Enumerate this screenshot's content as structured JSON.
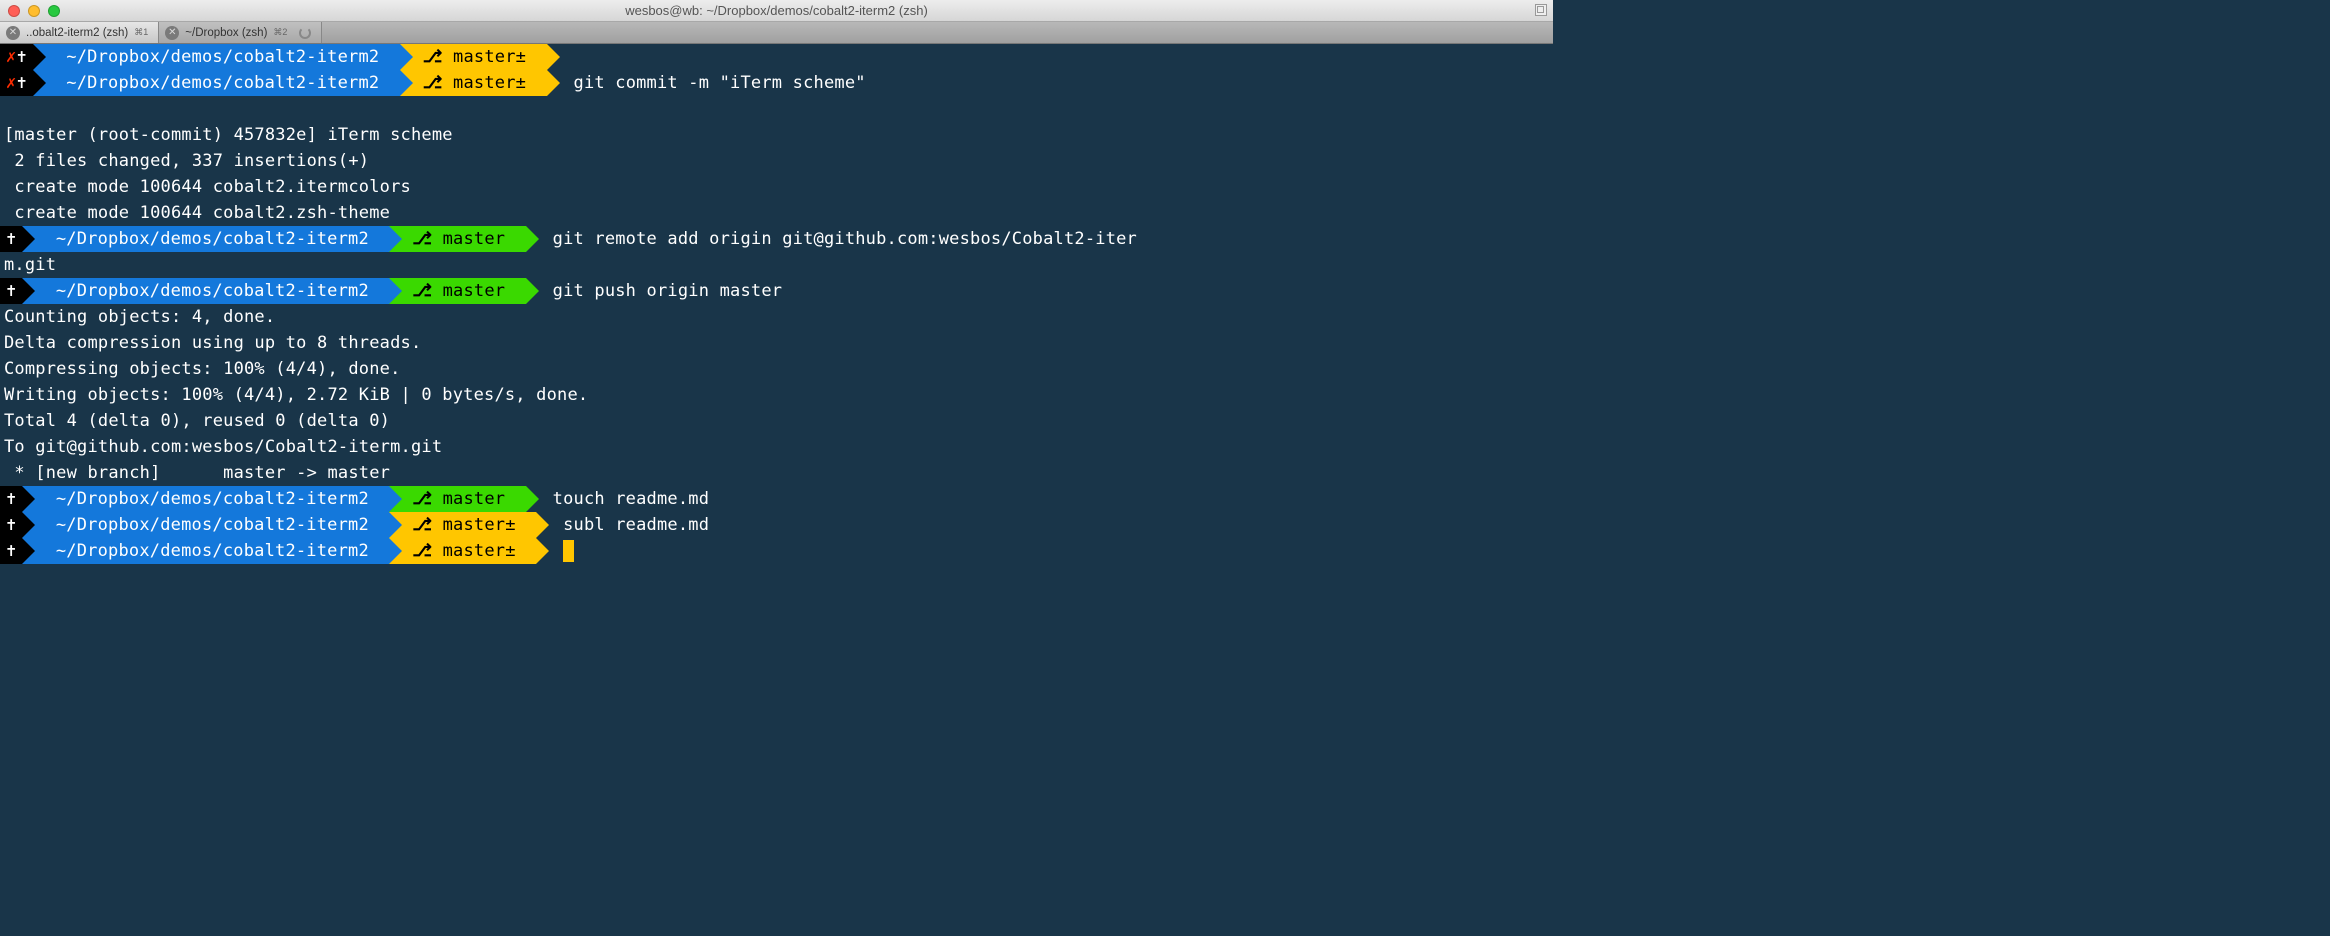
{
  "window": {
    "title": "wesbos@wb: ~/Dropbox/demos/cobalt2-iterm2 (zsh)"
  },
  "tabs": [
    {
      "label": "..obalt2-iterm2 (zsh)",
      "shortcut": "⌘1",
      "active": true
    },
    {
      "label": "~/Dropbox (zsh)",
      "shortcut": "⌘2",
      "active": false,
      "loading": true
    }
  ],
  "path": "~/Dropbox/demos/cobalt2-iterm2",
  "branch": "master",
  "dirty_suffix": "±",
  "prompts": [
    {
      "status_glyphs": "✗ ✝",
      "branch_color": "yellow",
      "dirty": true,
      "command": ""
    },
    {
      "status_glyphs": "✗ ✝",
      "branch_color": "yellow",
      "dirty": true,
      "command": "git commit -m \"iTerm scheme\""
    }
  ],
  "commit_output": [
    "[master (root-commit) 457832e] iTerm scheme",
    " 2 files changed, 337 insertions(+)",
    " create mode 100644 cobalt2.itermcolors",
    " create mode 100644 cobalt2.zsh-theme"
  ],
  "prompts2": [
    {
      "status_glyphs": "✝",
      "branch_color": "green",
      "dirty": false,
      "command": "git remote add origin git@github.com:wesbos/Cobalt2-iter",
      "wrap": "m.git"
    },
    {
      "status_glyphs": "✝",
      "branch_color": "green",
      "dirty": false,
      "command": "git push origin master"
    }
  ],
  "push_output": [
    "Counting objects: 4, done.",
    "Delta compression using up to 8 threads.",
    "Compressing objects: 100% (4/4), done.",
    "Writing objects: 100% (4/4), 2.72 KiB | 0 bytes/s, done.",
    "Total 4 (delta 0), reused 0 (delta 0)",
    "To git@github.com:wesbos/Cobalt2-iterm.git",
    " * [new branch]      master -> master"
  ],
  "prompts3": [
    {
      "status_glyphs": "✝",
      "branch_color": "green",
      "dirty": false,
      "command": "touch readme.md"
    },
    {
      "status_glyphs": "✝",
      "branch_color": "yellow",
      "dirty": true,
      "command": "subl readme.md"
    },
    {
      "status_glyphs": "✝",
      "branch_color": "yellow",
      "dirty": true,
      "command": "",
      "cursor": true
    }
  ]
}
